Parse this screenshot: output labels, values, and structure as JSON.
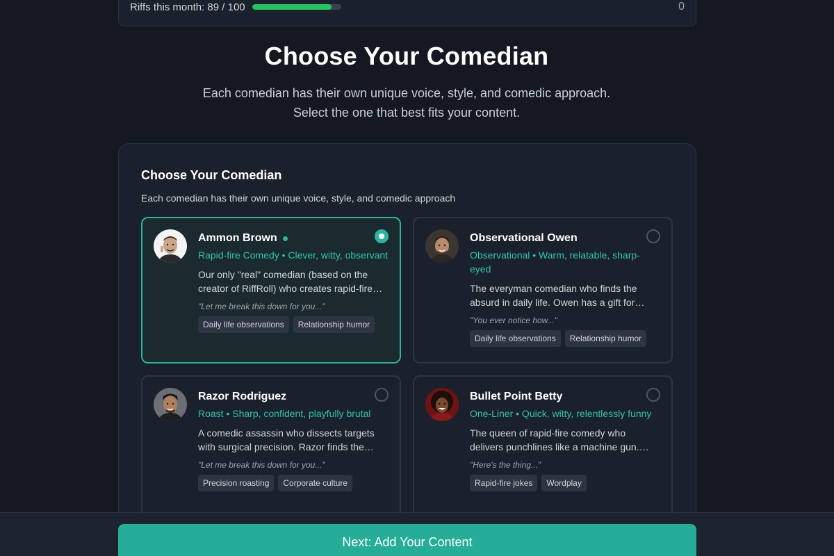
{
  "usage": {
    "label": "Riffs this month: 89 / 100",
    "progress_fraction": 0.89,
    "right_value": "0"
  },
  "hero": {
    "title": "Choose Your Comedian",
    "subtitle_line1": "Each comedian has their own unique voice, style, and comedic approach.",
    "subtitle_line2": "Select the one that best fits your content."
  },
  "panel": {
    "title": "Choose Your Comedian",
    "subtitle": "Each comedian has their own unique voice, style, and comedic approach"
  },
  "comedians": [
    {
      "name": "Ammon Brown",
      "style": "Rapid-fire Comedy • Clever, witty, observant",
      "description": "Our only \"real\" comedian (based on the creator of RiffRoll) who creates rapid-fire comedy",
      "quote": "\"Let me break this down for you...\"",
      "tags": [
        "Daily life observations",
        "Relationship humor"
      ],
      "selected": true,
      "online": true
    },
    {
      "name": "Observational Owen",
      "style": "Observational • Warm, relatable, sharp-eyed",
      "description": "The everyman comedian who finds the absurd in daily life. Owen has a gift for noticing",
      "quote": "\"You ever notice how...\"",
      "tags": [
        "Daily life observations",
        "Relationship humor"
      ],
      "selected": false,
      "online": false
    },
    {
      "name": "Razor Rodriguez",
      "style": "Roast • Sharp, confident, playfully brutal",
      "description": "A comedic assassin who dissects targets with surgical precision. Razor finds the weak spots",
      "quote": "\"Let me break this down for you...\"",
      "tags": [
        "Precision roasting",
        "Corporate culture"
      ],
      "selected": false,
      "online": false
    },
    {
      "name": "Bullet Point Betty",
      "style": "One-Liner • Quick, witty, relentlessly funny",
      "description": "The queen of rapid-fire comedy who delivers punchlines like a machine gun. Betty",
      "quote": "\"Here's the thing...\"",
      "tags": [
        "Rapid-fire jokes",
        "Wordplay"
      ],
      "selected": false,
      "online": false
    }
  ],
  "footer": {
    "next_label": "Next: Add Your Content"
  },
  "colors": {
    "accent": "#2bb5a0",
    "progress": "#22c55e",
    "background": "#131823",
    "panel": "#1b212c"
  }
}
